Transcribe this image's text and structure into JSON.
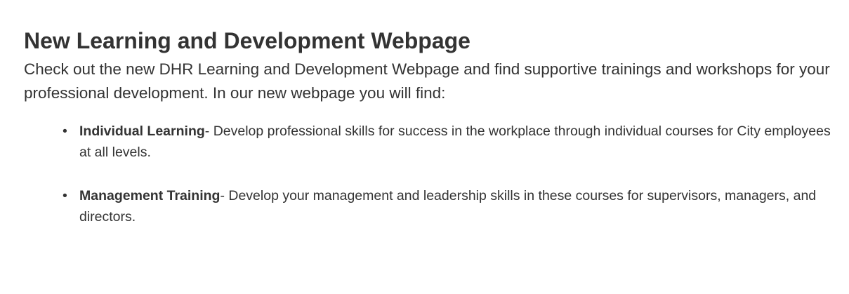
{
  "article": {
    "title": "New Learning and Development Webpage",
    "intro": "Check out the new DHR Learning and Development Webpage and find supportive trainings and workshops for your professional development. In our new webpage you will find:",
    "items": [
      {
        "name": "Individual Learning",
        "description": "- Develop professional skills for success in the workplace through individual courses for City employees at all levels."
      },
      {
        "name": "Management Training",
        "description": "- Develop your management and leadership skills in these courses for supervisors, managers, and directors."
      }
    ]
  }
}
